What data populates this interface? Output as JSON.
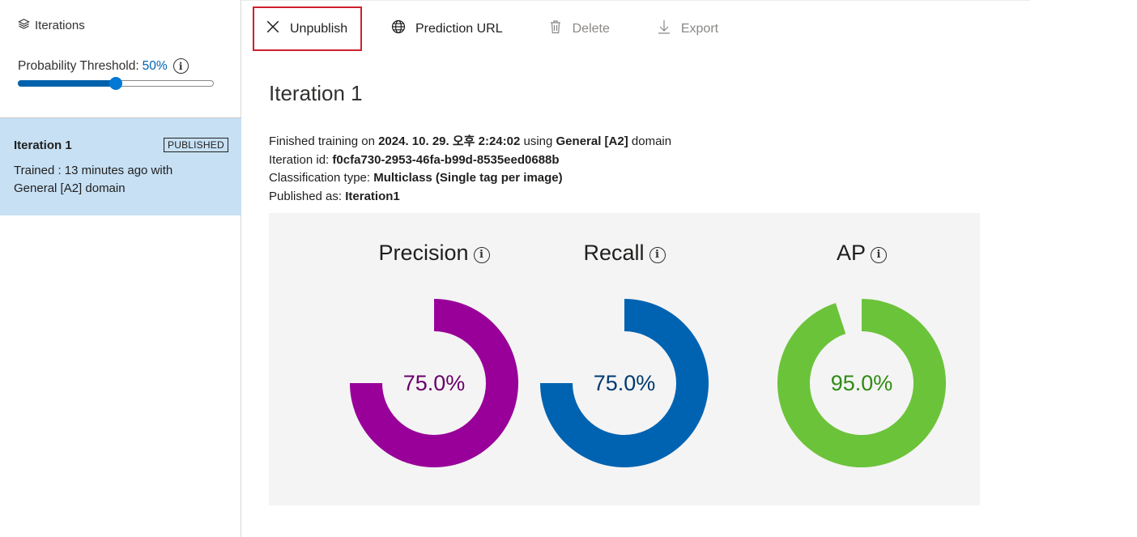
{
  "sidebar": {
    "header": "Iterations",
    "threshold_label": "Probability Threshold:",
    "threshold_value": "50%",
    "threshold_fraction": 0.5,
    "iteration": {
      "name": "Iteration 1",
      "badge": "PUBLISHED",
      "desc_line1": "Trained : 13 minutes ago with",
      "desc_line2": "General [A2] domain"
    }
  },
  "toolbar": {
    "unpublish": "Unpublish",
    "prediction_url": "Prediction URL",
    "delete": "Delete",
    "export": "Export"
  },
  "main": {
    "title": "Iteration 1",
    "details": {
      "l1_prefix": "Finished training on",
      "l1_date": "2024. 10. 29. 오후 2:24:02",
      "l1_mid": "using",
      "l1_domain": "General [A2]",
      "l1_suffix": "domain",
      "l2_label": "Iteration id:",
      "l2_value": "f0cfa730-2953-46fa-b99d-8535eed0688b",
      "l3_label": "Classification type:",
      "l3_value": "Multiclass (Single tag per image)",
      "l4_label": "Published as:",
      "l4_value": "Iteration1"
    },
    "metrics": [
      {
        "name": "Precision",
        "label": "75.0%",
        "value": 75.0,
        "color": "#990099",
        "text_color": "#680068"
      },
      {
        "name": "Recall",
        "label": "75.0%",
        "value": 75.0,
        "color": "#0063b1",
        "text_color": "#003a6f"
      },
      {
        "name": "AP",
        "label": "95.0%",
        "value": 95.0,
        "color": "#6bc33a",
        "text_color": "#2e8b12"
      }
    ]
  },
  "colors": {
    "accent": "#0078d4",
    "selected_bg": "#c7e0f4",
    "highlight_border": "#d0202f",
    "disabled_text": "#8a8886"
  }
}
